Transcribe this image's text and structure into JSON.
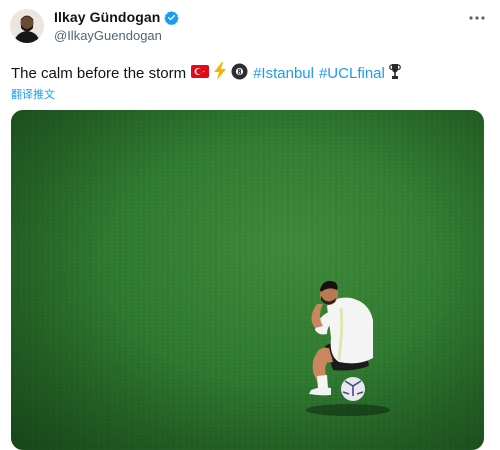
{
  "author": {
    "display_name": "Ilkay Gündogan",
    "handle": "@IlkayGuendogan",
    "verified": true
  },
  "tweet": {
    "text": "The calm before the storm",
    "emojis": [
      "turkey-flag",
      "lightning",
      "8-ball"
    ],
    "hashtags": [
      "#Istanbul",
      "#UCLfinal"
    ],
    "trailing_emoji": "trophy",
    "translate_label": "翻译推文"
  },
  "media": {
    "alt_subject": "player-sitting-on-ball"
  },
  "colors": {
    "accent": "#1d9bf0",
    "text": "#0f1419",
    "secondary": "#536471",
    "pitch": "#2f7a30"
  }
}
